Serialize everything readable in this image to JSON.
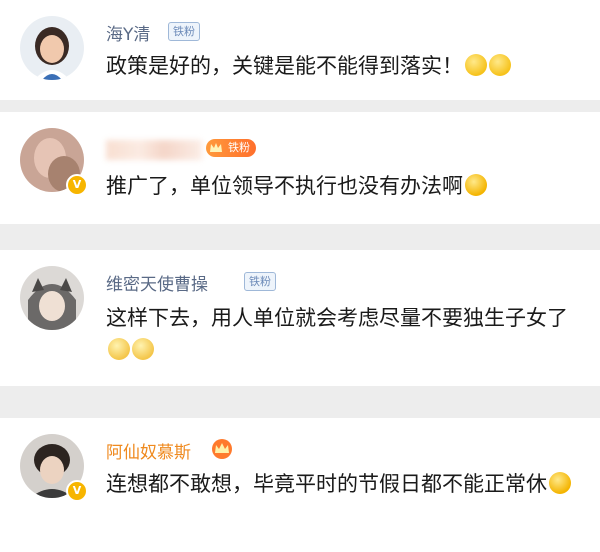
{
  "comments": [
    {
      "username": "海Y清",
      "badge": "铁粉",
      "text": "政策是好的，关键是能不能得到落实！",
      "emojis": [
        "sweat-smile-icon",
        "sweat-smile-icon"
      ]
    },
    {
      "username": "",
      "badge": "铁粉",
      "text": "推广了，单位领导不执行也没有办法啊",
      "emojis": [
        "laugh-cry-icon"
      ]
    },
    {
      "username": "维密天使曹操",
      "badge": "铁粉",
      "text": "这样下去，用人单位就会考虑尽量不要独生子女了",
      "emojis": [
        "dizzy-face-icon",
        "dizzy-face-icon"
      ]
    },
    {
      "username": "阿仙奴慕斯",
      "text": "连想都不敢想，毕竟平时的节假日都不能正常休",
      "emojis": [
        "crying-face-icon"
      ]
    }
  ],
  "colors": {
    "username": "#5a6a86",
    "vip_username": "#ef8a1f",
    "verified_badge": "#f7b500",
    "fan_badge_border": "#9fb8d8"
  }
}
